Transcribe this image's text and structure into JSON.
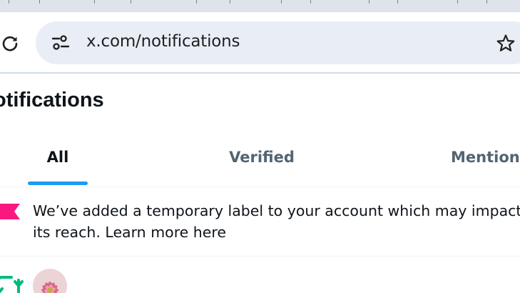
{
  "browser": {
    "url": "x.com/notifications",
    "icons": {
      "reload": "reload-icon",
      "site_info": "tune-icon",
      "bookmark": "star-icon"
    }
  },
  "page": {
    "title": "otifications"
  },
  "tabs": [
    {
      "label": "All",
      "active": true
    },
    {
      "label": "Verified",
      "active": false
    },
    {
      "label": "Mentions",
      "active": false
    }
  ],
  "notice": {
    "text": "We’ve added a temporary label to your account which may impact its reach. Learn more here",
    "icon": "flag-icon",
    "icon_color": "#f91880"
  },
  "activity": {
    "icon": "retweet-icon",
    "icon_color": "#00ba7c"
  },
  "colors": {
    "accent": "#1d9bf0",
    "text_primary": "#0f1419",
    "text_secondary": "#536471",
    "omnibox_bg": "#e9eef6"
  }
}
